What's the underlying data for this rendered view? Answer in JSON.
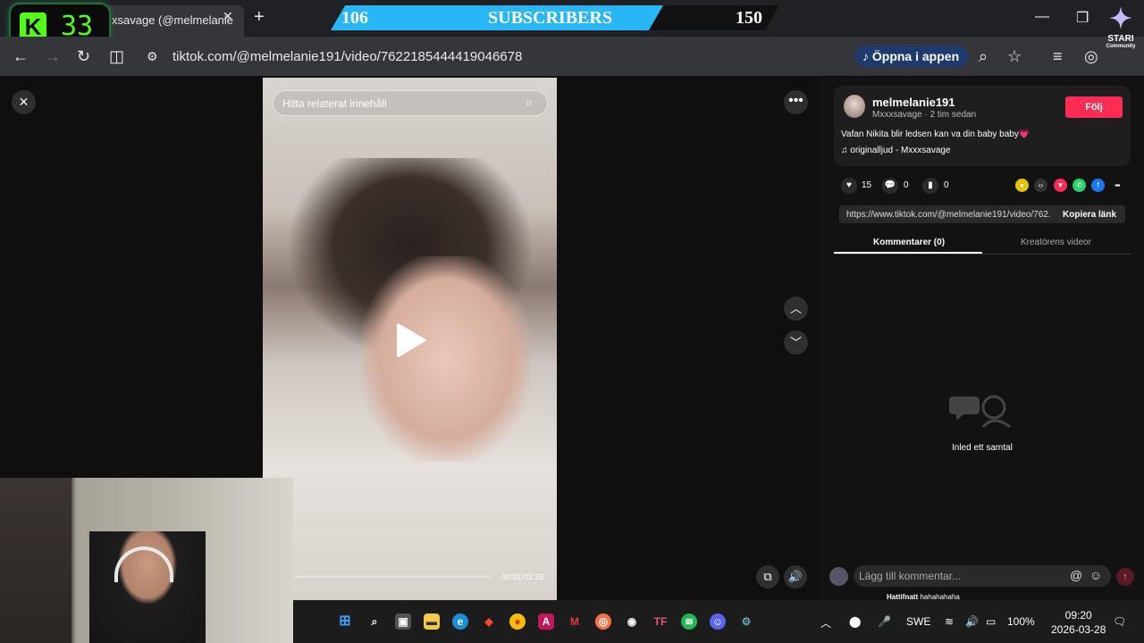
{
  "browser": {
    "tab_title": "xsavage (@melmelanie",
    "url": "tiktok.com/@melmelanie191/video/7622185444419046678",
    "open_app": "Öppna i appen"
  },
  "overlay": {
    "kick_count": "33",
    "subscribers_current": "106",
    "subscribers_label": "SUBSCRIBERS",
    "subscribers_goal": "150",
    "stari_label": "STARI",
    "stari_sub": "Community"
  },
  "video": {
    "search_placeholder": "Hitta relaterat innehåll",
    "time": "00:01/02:16"
  },
  "panel": {
    "username": "melmelanie191",
    "meta": "Mxxxsavage · 2 tim sedan",
    "follow": "Följ",
    "description": "Vafan Nikita blir ledsen kan va din baby baby💗",
    "music": "originalljud - Mxxxsavage",
    "likes": "15",
    "comments": "0",
    "saves": "0",
    "link": "https://www.tiktok.com/@melmelanie191/video/762...",
    "copy_link": "Kopiera länk",
    "tab_comments": "Kommentarer (0)",
    "tab_creator": "Kreatörens videor",
    "empty_text": "Inled ett samtal",
    "comment_placeholder": "Lägg till kommentar...",
    "chat_user": "Hattifnatt",
    "chat_msg": "hahahahaha"
  },
  "taskbar": {
    "lang": "SWE",
    "battery": "100%",
    "time": "09:20",
    "date": "2026-03-28"
  },
  "colors": {
    "follow": "#fe2c55",
    "banner": "#29b6f6",
    "kick": "#53fc18"
  }
}
